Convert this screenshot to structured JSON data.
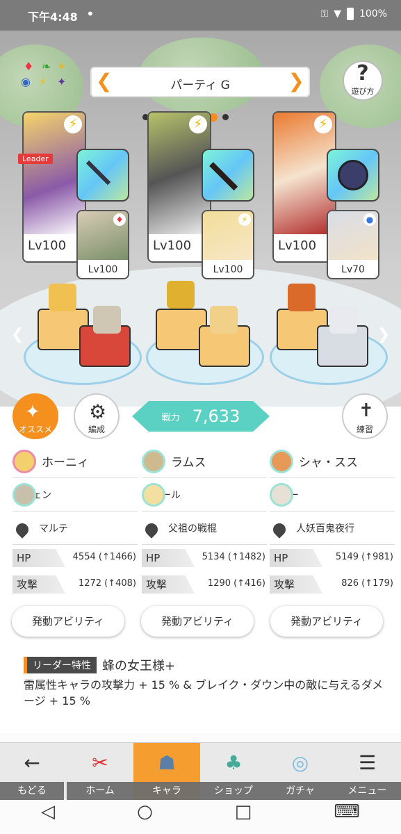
{
  "status": {
    "time": "下午4:48",
    "dot": "•",
    "battery": "100%"
  },
  "party": {
    "title": "パーティ G",
    "page_index": 6,
    "page_count": 8
  },
  "help_label": "遊び方",
  "leader_badge": "Leader",
  "members": [
    {
      "main_lv": "Lv100",
      "sub_lv": "Lv100",
      "sub_badge": "♦",
      "main_color": "#f2c95a",
      "sub_color": "#d0c6b6"
    },
    {
      "main_lv": "Lv100",
      "sub_lv": "Lv100",
      "sub_badge": "⚡",
      "main_color": "#c8c8b4",
      "sub_color": "#f0d9a0"
    },
    {
      "main_lv": "Lv100",
      "sub_lv": "Lv70",
      "sub_badge": "●",
      "main_color": "#e9873a",
      "sub_color": "#cfd7e4"
    }
  ],
  "buttons": {
    "recommend": "オススメ",
    "formation": "編成",
    "practice": "練習"
  },
  "power": {
    "label": "戦力",
    "value": "7,633"
  },
  "columns": [
    {
      "main_name": "ホーニィ",
      "sub_name": "スヴェン",
      "weapon": "マルテ",
      "hp_label": "HP",
      "hp": "4554 (↑1466)",
      "atk_label": "攻撃",
      "atk": "1272 (↑408)",
      "ability": "発動アビリティ"
    },
    {
      "main_name": "ラムス",
      "sub_name": "ルナール",
      "weapon": "父祖の戦棍",
      "hp_label": "HP",
      "hp": "5134 (↑1482)",
      "atk_label": "攻撃",
      "atk": "1290 (↑416)",
      "ability": "発動アビリティ"
    },
    {
      "main_name": "シャ・スス",
      "sub_name": "ラナー",
      "weapon": "人妖百鬼夜行",
      "hp_label": "HP",
      "hp": "5149 (↑981)",
      "atk_label": "攻撃",
      "atk": "826 (↑179)",
      "ability": "発動アビリティ"
    }
  ],
  "leader_trait": {
    "tag": "リーダー特性",
    "name": "蜂の女王様+",
    "description": "雷属性キャラの攻撃力 + 15 % & ブレイク・ダウン中の敵に与えるダメージ + 15 %"
  },
  "nav": {
    "back": "もどる",
    "home": "ホーム",
    "chara": "キャラ",
    "shop": "ショップ",
    "gacha": "ガチャ",
    "menu": "メニュー"
  },
  "colors": {
    "accent": "#f5901e",
    "power": "#5bd1c4"
  }
}
